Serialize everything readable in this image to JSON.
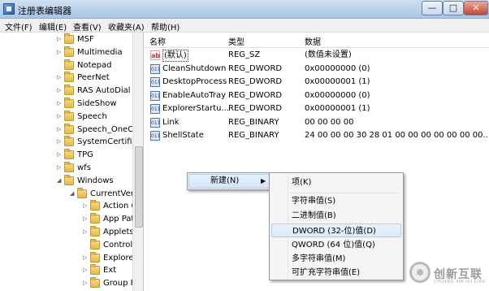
{
  "window": {
    "title": "注册表编辑器",
    "controls": {
      "minimize": "—",
      "maximize": "□",
      "close": "✕"
    }
  },
  "menubar": [
    "文件(F)",
    "编辑(E)",
    "查看(V)",
    "收藏夹(A)",
    "帮助(H)"
  ],
  "tree": {
    "items": [
      {
        "label": "MSF",
        "expander": "▷"
      },
      {
        "label": "Multimedia",
        "expander": "▷"
      },
      {
        "label": "Notepad",
        "expander": ""
      },
      {
        "label": "PeerNet",
        "expander": "▷"
      },
      {
        "label": "RAS AutoDial",
        "expander": "▷"
      },
      {
        "label": "SideShow",
        "expander": "▷"
      },
      {
        "label": "Speech",
        "expander": "▷"
      },
      {
        "label": "Speech_OneCore",
        "expander": "▷"
      },
      {
        "label": "SystemCertificates",
        "expander": "▷"
      },
      {
        "label": "TPG",
        "expander": "▷"
      },
      {
        "label": "wfs",
        "expander": "▷"
      },
      {
        "label": "Windows",
        "expander": "◢"
      },
      {
        "label": "CurrentVersion",
        "expander": "◢"
      },
      {
        "label": "Action Center",
        "expander": "▷"
      },
      {
        "label": "App Paths",
        "expander": "▷"
      },
      {
        "label": "Applets",
        "expander": "▷"
      },
      {
        "label": "Control Panel",
        "expander": ""
      },
      {
        "label": "Explorer",
        "expander": "▷"
      },
      {
        "label": "Ext",
        "expander": "▷"
      },
      {
        "label": "Group Policy",
        "expander": "▷"
      }
    ]
  },
  "list": {
    "headers": {
      "name": "名称",
      "type": "类型",
      "data": "数据"
    },
    "rows": [
      {
        "icon": "ab",
        "name": "(默认)",
        "type": "REG_SZ",
        "data": "(数值未设置)"
      },
      {
        "icon": "011",
        "name": "CleanShutdown",
        "type": "REG_DWORD",
        "data": "0x00000000 (0)"
      },
      {
        "icon": "011",
        "name": "DesktopProcess",
        "type": "REG_DWORD",
        "data": "0x00000001 (1)"
      },
      {
        "icon": "011",
        "name": "EnableAutoTray",
        "type": "REG_DWORD",
        "data": "0x00000000 (0)"
      },
      {
        "icon": "011",
        "name": "ExplorerStartu...",
        "type": "REG_DWORD",
        "data": "0x00000001 (1)"
      },
      {
        "icon": "011",
        "name": "Link",
        "type": "REG_BINARY",
        "data": "00 00 00 00"
      },
      {
        "icon": "011",
        "name": "ShellState",
        "type": "REG_BINARY",
        "data": "24 00 00 00 30 28 01 00 00 00 00 00 00 00..."
      }
    ]
  },
  "context_menu": {
    "new_label": "新建(N)",
    "arrow": "▶",
    "submenu": [
      "项(K)",
      "字符串值(S)",
      "二进制值(B)",
      "DWORD (32-位)值(D)",
      "QWORD (64 位)值(Q)",
      "多字符串值(M)",
      "可扩充字符串值(E)"
    ]
  },
  "watermark": {
    "text": "创新互联",
    "sub": "CHUANG XIN HU LIAN"
  }
}
